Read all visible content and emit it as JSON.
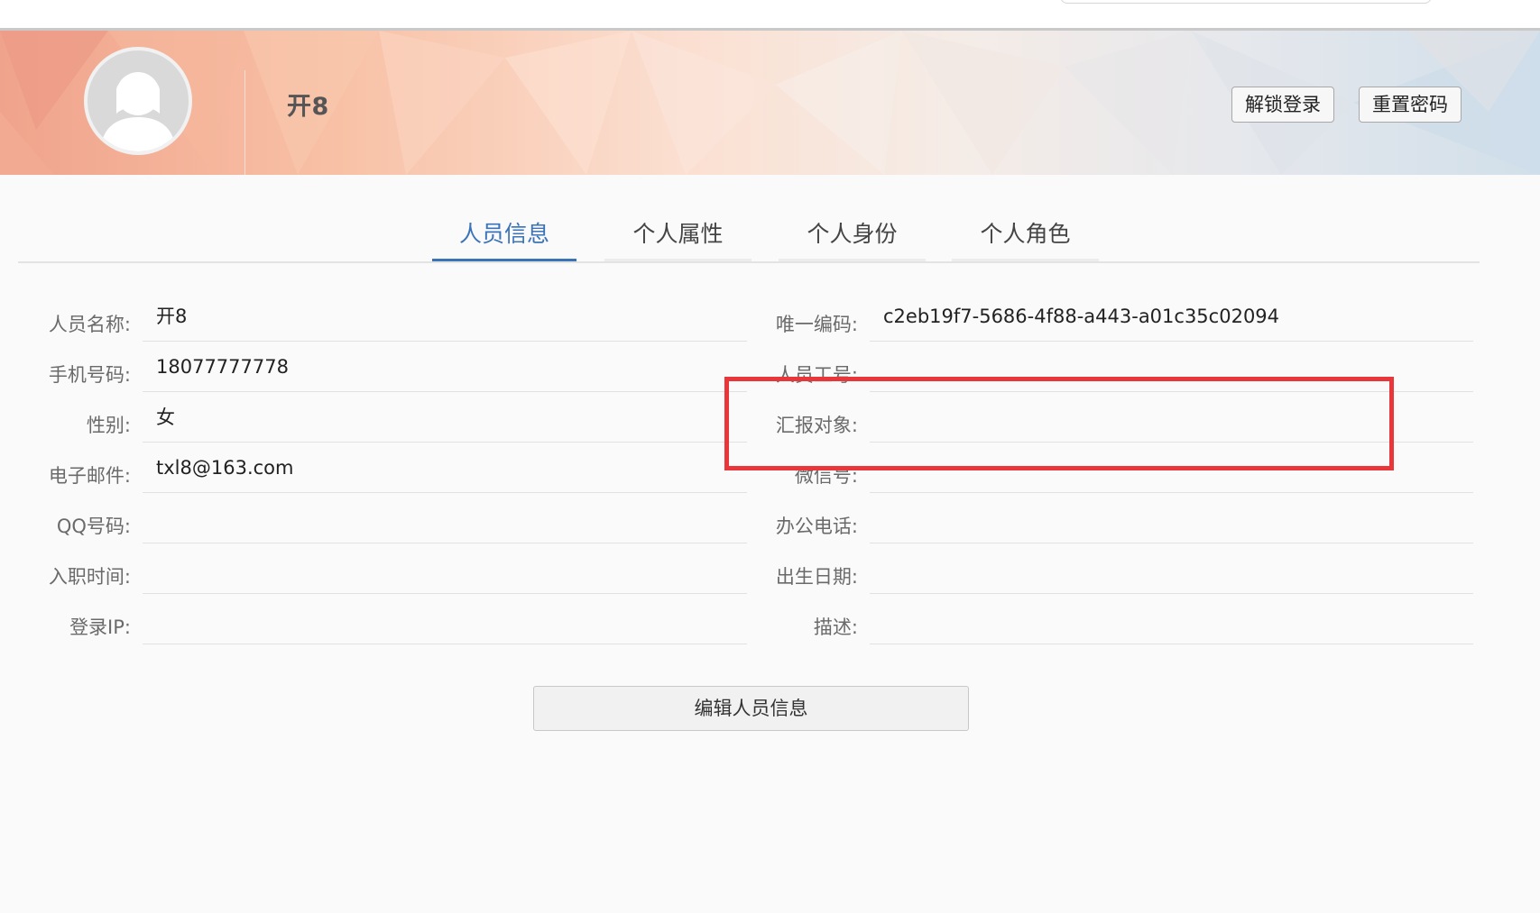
{
  "header": {
    "user_name": "开8",
    "buttons": {
      "unlock_login": "解锁登录",
      "reset_password": "重置密码"
    }
  },
  "tabs": [
    {
      "label": "人员信息",
      "active": true
    },
    {
      "label": "个人属性",
      "active": false
    },
    {
      "label": "个人身份",
      "active": false
    },
    {
      "label": "个人角色",
      "active": false
    }
  ],
  "left_fields": [
    {
      "label": "人员名称:",
      "value": "开8"
    },
    {
      "label": "手机号码:",
      "value": "18077777778"
    },
    {
      "label": "性别:",
      "value": "女"
    },
    {
      "label": "电子邮件:",
      "value": "txl8@163.com"
    },
    {
      "label": "QQ号码:",
      "value": ""
    },
    {
      "label": "入职时间:",
      "value": ""
    },
    {
      "label": "登录IP:",
      "value": ""
    }
  ],
  "right_fields": [
    {
      "label": "唯一编码:",
      "value": "c2eb19f7-5686-4f88-a443-a01c35c02094"
    },
    {
      "label": "人员工号:",
      "value": ""
    },
    {
      "label": "汇报对象:",
      "value": ""
    },
    {
      "label": "微信号:",
      "value": ""
    },
    {
      "label": "办公电话:",
      "value": ""
    },
    {
      "label": "出生日期:",
      "value": ""
    },
    {
      "label": "描述:",
      "value": ""
    }
  ],
  "actions": {
    "edit_label": "编辑人员信息"
  },
  "colors": {
    "accent": "#3b73b9",
    "highlight": "#e8363a"
  }
}
